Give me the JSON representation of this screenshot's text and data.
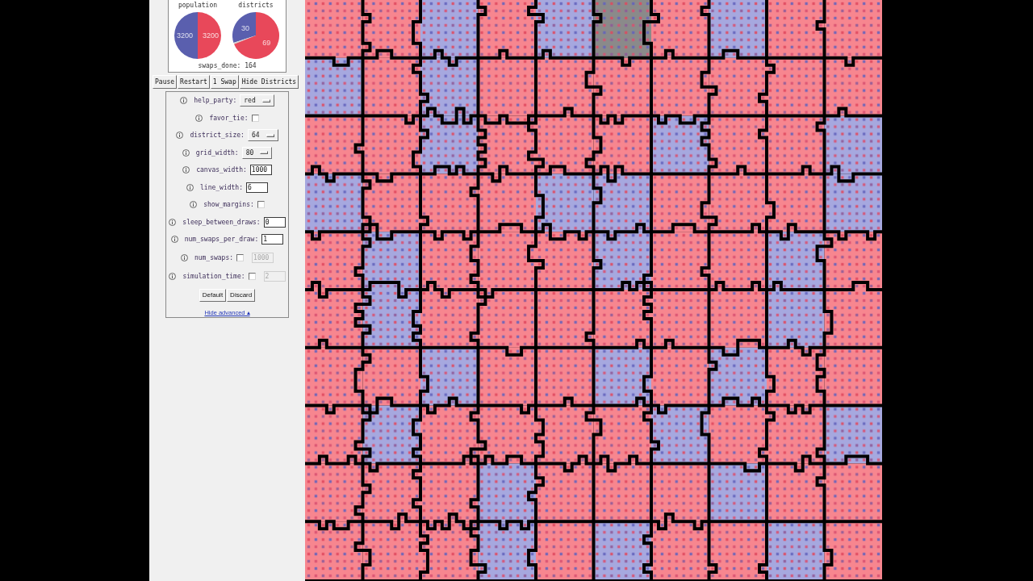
{
  "stats": {
    "charts": [
      {
        "chart_data": [
          {
            "type": "pie",
            "title": "population",
            "values": [
              3200,
              3200
            ],
            "colors": [
              "#5a5fae",
              "#e8485a"
            ],
            "data_labels": true
          }
        ]
      },
      {
        "chart_data": [
          {
            "type": "pie",
            "title": "districts",
            "values": [
              30,
              1,
              69
            ],
            "colors": [
              "#5a5fae",
              "#d4d4d4",
              "#e8485a"
            ],
            "value_labels": [
              "30",
              null,
              "69"
            ]
          }
        ]
      }
    ],
    "swaps_done": "swaps_done: 164"
  },
  "buttons": [
    {
      "label": "Pause"
    },
    {
      "label": "Restart"
    },
    {
      "label": "1 Swap"
    },
    {
      "label": "Hide Districts"
    }
  ],
  "settings": [
    {
      "kind": "dropdown",
      "label": "help_party:",
      "value": "red"
    },
    {
      "kind": "checkbox",
      "label": "favor_tie:",
      "checked": false
    },
    {
      "kind": "dropdown",
      "label": "district_size:",
      "value": "64"
    },
    {
      "kind": "dropdown",
      "label": "grid_width:",
      "value": "80"
    },
    {
      "kind": "input",
      "label": "canvas_width:",
      "value": "1000"
    },
    {
      "kind": "input",
      "label": "line_width:",
      "value": "6"
    },
    {
      "kind": "checkbox",
      "label": "show_margins:",
      "checked": false
    },
    {
      "kind": "input",
      "label": "sleep_between_draws:",
      "value": "0"
    },
    {
      "kind": "input",
      "label": "num_swaps_per_draw:",
      "value": "1"
    },
    {
      "kind": "optional_input",
      "label": "num_swaps:",
      "checked": false,
      "value": "1000",
      "disabled": true
    },
    {
      "kind": "optional_input",
      "label": "simulation_time:",
      "checked": false,
      "value": "2",
      "disabled": true
    }
  ],
  "actions": [
    {
      "label": "Default"
    },
    {
      "label": "Discard"
    }
  ],
  "advanced_link": "Hide advanced ▴"
}
